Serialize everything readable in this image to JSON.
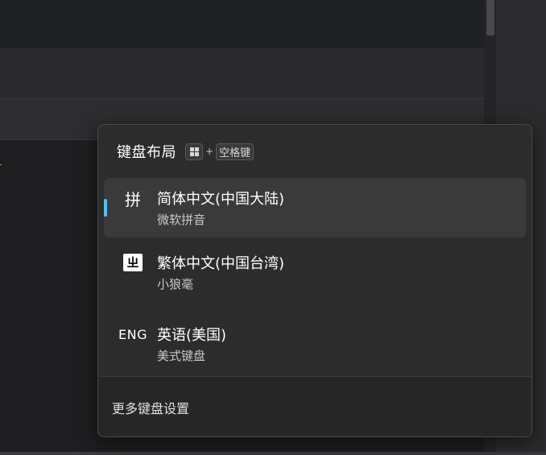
{
  "panel": {
    "title": "键盘布局",
    "shortcut": {
      "win_icon": "windows-logo-icon",
      "plus": "+",
      "space_key": "空格键"
    },
    "items": [
      {
        "icon_text": "拼",
        "icon": "pinyin-icon",
        "name": "简体中文(中国大陆)",
        "sub": "微软拼音",
        "selected": true
      },
      {
        "icon_text": "ㄓ",
        "icon": "bopomofo-icon",
        "name": "繁体中文(中国台湾)",
        "sub": "小狼毫",
        "selected": false
      },
      {
        "icon_text": "ENG",
        "icon": "eng-icon",
        "name": "英语(美国)",
        "sub": "美式键盘",
        "selected": false
      }
    ],
    "footer_link": "更多键盘设置"
  },
  "colors": {
    "accent": "#4cc2ff",
    "panel_bg": "#2c2c2c",
    "selected_bg": "#3a3a3a"
  }
}
